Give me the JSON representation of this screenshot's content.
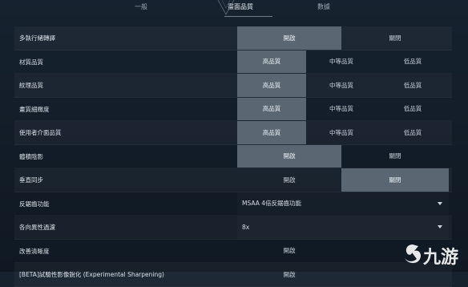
{
  "tabs": [
    {
      "label": "一般"
    },
    {
      "label": "畫面品質"
    },
    {
      "label": "數據"
    }
  ],
  "settings": [
    {
      "label": "多執行緒轉譯",
      "options": [
        "開啟",
        "關閉"
      ],
      "selected": 0
    },
    {
      "label": "材質品質",
      "options": [
        "高品質",
        "中等品質",
        "低品質"
      ],
      "selected": 0
    },
    {
      "label": "紋理品質",
      "options": [
        "高品質",
        "中等品質",
        "低品質"
      ],
      "selected": 0
    },
    {
      "label": "畫質細緻度",
      "options": [
        "高品質",
        "中等品質",
        "低品質"
      ],
      "selected": 0
    },
    {
      "label": "使用者介面品質",
      "options": [
        "高品質",
        "中等品質",
        "低品質"
      ],
      "selected": 0
    },
    {
      "label": "體積陰影",
      "options": [
        "開啟",
        "關閉"
      ],
      "selected": 0
    },
    {
      "label": "垂直同步",
      "options": [
        "開啟",
        "關閉"
      ],
      "selected": 1
    },
    {
      "label": "反鋸齒功能",
      "dropdown": "MSAA 4倍反鋸齒功能"
    },
    {
      "label": "各向異性過濾",
      "dropdown": "8x"
    },
    {
      "label": "改善清晰度",
      "options": [
        "開啟"
      ],
      "selected": -1
    },
    {
      "label": "[BETA]試驗性影像銳化 (Experimental Sharpening)",
      "options": [
        "開啟"
      ],
      "selected": -1
    }
  ],
  "watermark": {
    "text": "九游",
    "icon": "jiuyou-logo-icon"
  }
}
